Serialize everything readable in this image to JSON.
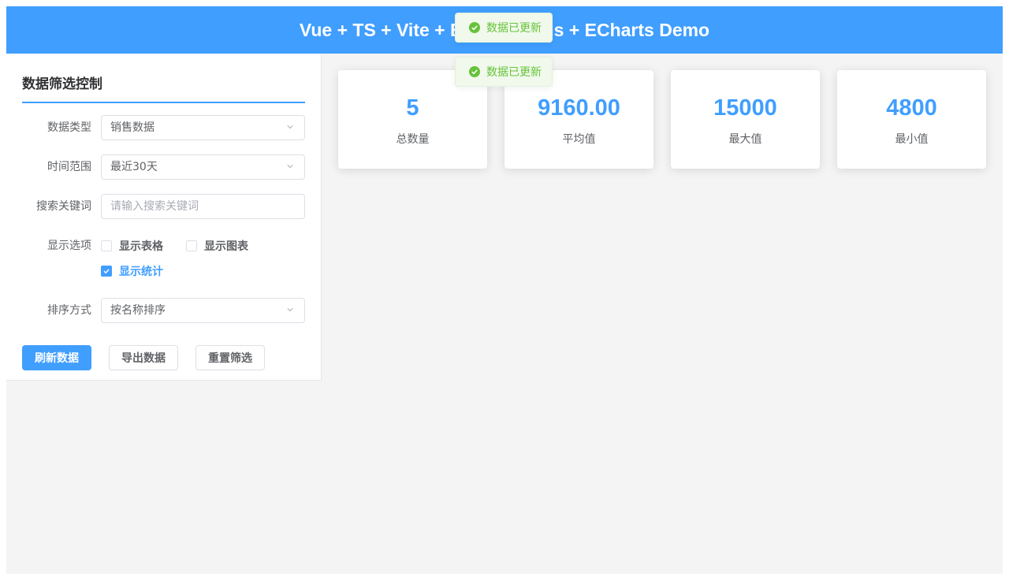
{
  "header": {
    "title": "Vue + TS + Vite + Element Plus + ECharts Demo"
  },
  "sidebar": {
    "title": "数据筛选控制",
    "data_type": {
      "label": "数据类型",
      "value": "销售数据"
    },
    "time_range": {
      "label": "时间范围",
      "value": "最近30天"
    },
    "search": {
      "label": "搜索关键词",
      "value": "",
      "placeholder": "请输入搜索关键词"
    },
    "display": {
      "label": "显示选项",
      "options": [
        {
          "label": "显示表格",
          "checked": false
        },
        {
          "label": "显示图表",
          "checked": false
        },
        {
          "label": "显示统计",
          "checked": true
        }
      ]
    },
    "sort": {
      "label": "排序方式",
      "value": "按名称排序"
    },
    "buttons": {
      "refresh": "刷新数据",
      "export": "导出数据",
      "reset": "重置筛选"
    }
  },
  "stats": [
    {
      "value": "5",
      "label": "总数量"
    },
    {
      "value": "9160.00",
      "label": "平均值"
    },
    {
      "value": "15000",
      "label": "最大值"
    },
    {
      "value": "4800",
      "label": "最小值"
    }
  ],
  "toasts": [
    {
      "text": "数据已更新",
      "icon": "success-check-icon"
    },
    {
      "text": "数据已更新",
      "icon": "success-check-icon"
    }
  ],
  "colors": {
    "primary": "#409eff",
    "success": "#67c23a",
    "success_bg": "#f0f9eb",
    "background": "#f4f4f4"
  }
}
